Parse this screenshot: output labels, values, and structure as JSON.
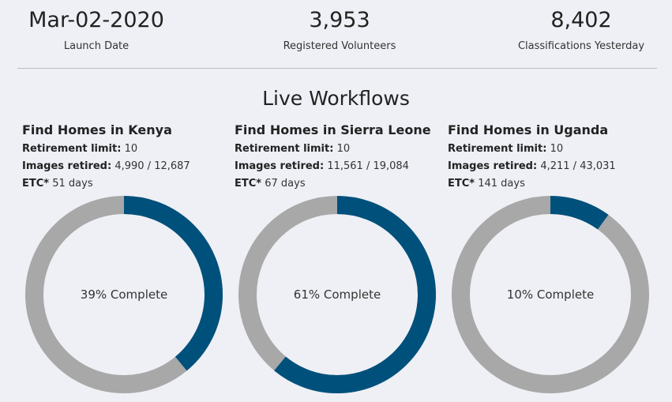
{
  "stats": {
    "launch_date": {
      "value": "Mar-02-2020",
      "label": "Launch Date"
    },
    "volunteers": {
      "value": "3,953",
      "label": "Registered Volunteers"
    },
    "classifications": {
      "value": "8,402",
      "label": "Classifications Yesterday"
    }
  },
  "section_title": "Live Workflows",
  "labels": {
    "retirement": "Retirement limit:",
    "images_retired": "Images retired:",
    "etc": "ETC*"
  },
  "colors": {
    "progress": "#00507c",
    "track": "#a8a8a8",
    "background": "#eef0f5"
  },
  "workflows": [
    {
      "title": "Find Homes in Kenya",
      "retirement_limit": "10",
      "images_retired": "4,990 / 12,687",
      "etc": "51 days",
      "percent": 39,
      "complete_label": "39% Complete"
    },
    {
      "title": "Find Homes in Sierra Leone",
      "retirement_limit": "10",
      "images_retired": "11,561 / 19,084",
      "etc": "67 days",
      "percent": 61,
      "complete_label": "61% Complete"
    },
    {
      "title": "Find Homes in Uganda",
      "retirement_limit": "10",
      "images_retired": "4,211 / 43,031",
      "etc": "141 days",
      "percent": 10,
      "complete_label": "10% Complete"
    }
  ]
}
